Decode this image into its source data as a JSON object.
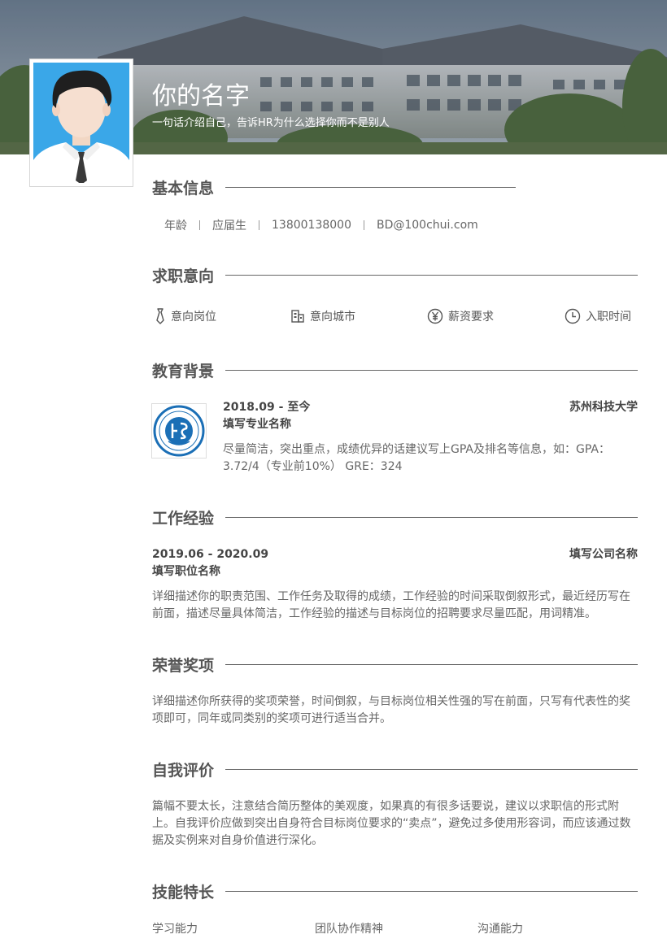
{
  "header": {
    "name": "你的名字",
    "tagline": "一句话介绍自己，告诉HR为什么选择你而不是别人"
  },
  "basic_info": {
    "title": "基本信息",
    "items": [
      "年龄",
      "应届生",
      "13800138000",
      "BD@100chui.com"
    ]
  },
  "job_intent": {
    "title": "求职意向",
    "items": [
      {
        "icon": "tie-icon",
        "label": "意向岗位"
      },
      {
        "icon": "building-icon",
        "label": "意向城市"
      },
      {
        "icon": "yen-icon",
        "label": "薪资要求"
      },
      {
        "icon": "clock-icon",
        "label": "入职时间"
      }
    ]
  },
  "education": {
    "title": "教育背景",
    "period": "2018.09 - 至今",
    "school": "苏州科技大学",
    "major": "填写专业名称",
    "description": "尽量简洁，突出重点，成绩优异的话建议写上GPA及排名等信息，如：GPA：3.72/4（专业前10%） GRE：324"
  },
  "work": {
    "title": "工作经验",
    "period": "2019.06 - 2020.09",
    "company": "填写公司名称",
    "position": "填写职位名称",
    "description": "详细描述你的职责范围、工作任务及取得的成绩，工作经验的时间采取倒叙形式，最近经历写在前面，描述尽量具体简洁，工作经验的描述与目标岗位的招聘要求尽量匹配，用词精准。"
  },
  "honors": {
    "title": "荣誉奖项",
    "description": "详细描述你所获得的奖项荣誉，时间倒叙，与目标岗位相关性强的写在前面，只写有代表性的奖项即可，同年或同类别的奖项可进行适当合并。"
  },
  "self_eval": {
    "title": "自我评价",
    "description": "篇幅不要太长，注意结合简历整体的美观度，如果真的有很多话要说，建议以求职信的形式附上。自我评价应做到突出自身符合目标岗位要求的“卖点”，避免过多使用形容词，而应该通过数据及实例来对自身价值进行深化。"
  },
  "skills": {
    "title": "技能特长",
    "items": [
      "学习能力",
      "团队协作精神",
      "沟通能力"
    ]
  },
  "colors": {
    "accent_blue": "#3aa7e8",
    "text": "#555555",
    "line": "#666666"
  }
}
